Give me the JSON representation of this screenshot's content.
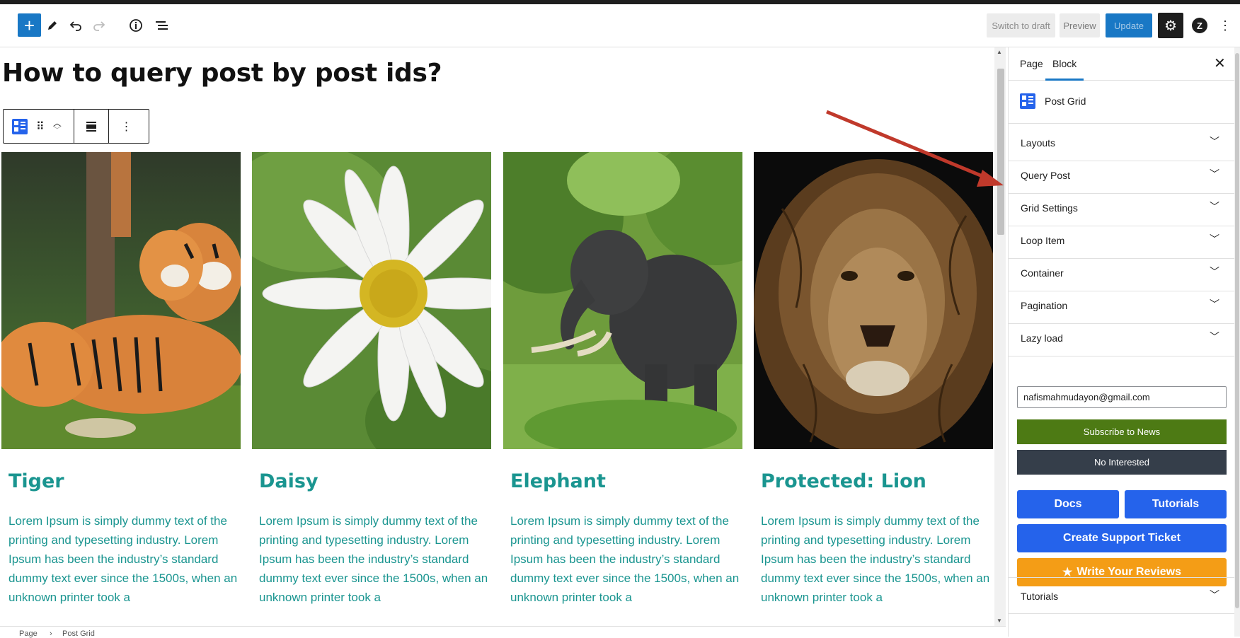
{
  "toolbar": {
    "add_label": "+",
    "switch_to_draft": "Switch to draft",
    "preview": "Preview",
    "update": "Update"
  },
  "editor": {
    "post_title": "How to query post by post ids?"
  },
  "cards": [
    {
      "title": "Tiger",
      "text": "Lorem Ipsum is simply dummy text of the printing and typesetting industry. Lorem Ipsum has been the industry’s standard dummy text ever since the 1500s, when an unknown printer took a"
    },
    {
      "title": "Daisy",
      "text": "Lorem Ipsum is simply dummy text of the printing and typesetting industry. Lorem Ipsum has been the industry’s standard dummy text ever since the 1500s, when an unknown printer took a"
    },
    {
      "title": "Elephant",
      "text": "Lorem Ipsum is simply dummy text of the printing and typesetting industry. Lorem Ipsum has been the industry’s standard dummy text ever since the 1500s, when an unknown printer took a"
    },
    {
      "title": "Protected: Lion",
      "text": "Lorem Ipsum is simply dummy text of the printing and typesetting industry. Lorem Ipsum has been the industry’s standard dummy text ever since the 1500s, when an unknown printer took a"
    }
  ],
  "statusbar": {
    "crumb_1": "Page",
    "separator": "›",
    "crumb_2": "Post Grid"
  },
  "sidebar": {
    "tabs": [
      {
        "label": "Page"
      },
      {
        "label": "Block"
      }
    ],
    "close": "✕",
    "block_name": "Post Grid",
    "panels": [
      {
        "label": "Layouts"
      },
      {
        "label": "Query Post"
      },
      {
        "label": "Grid Settings"
      },
      {
        "label": "Loop Item"
      },
      {
        "label": "Container"
      },
      {
        "label": "Pagination"
      },
      {
        "label": "Lazy load"
      }
    ],
    "email_value": "nafismahmudayon@gmail.com",
    "subscribe": "Subscribe to News",
    "no_interested": "No Interested",
    "docs": "Docs",
    "tutorials": "Tutorials",
    "support": "Create Support Ticket",
    "reviews": "Write Your Reviews",
    "bottom_panel": "Tutorials"
  },
  "colors": {
    "wp_blue": "#1978c5",
    "accent_teal": "#1a9590",
    "button_blue": "#2563eb",
    "subscribe_green": "#4d7a14",
    "no_interest_dark": "#353e4a",
    "review_orange": "#f49d16",
    "annotation_arrow": "#c0392b"
  },
  "icons": [
    "pencil-icon",
    "undo-icon",
    "redo-icon",
    "info-icon",
    "list-view-icon",
    "gear-icon",
    "z-logo-icon",
    "more-vertical-icon",
    "post-grid-icon",
    "drag-handle-icon",
    "move-up-icon",
    "move-down-icon",
    "align-icon",
    "chevron-down-icon",
    "star-icon",
    "close-icon"
  ]
}
